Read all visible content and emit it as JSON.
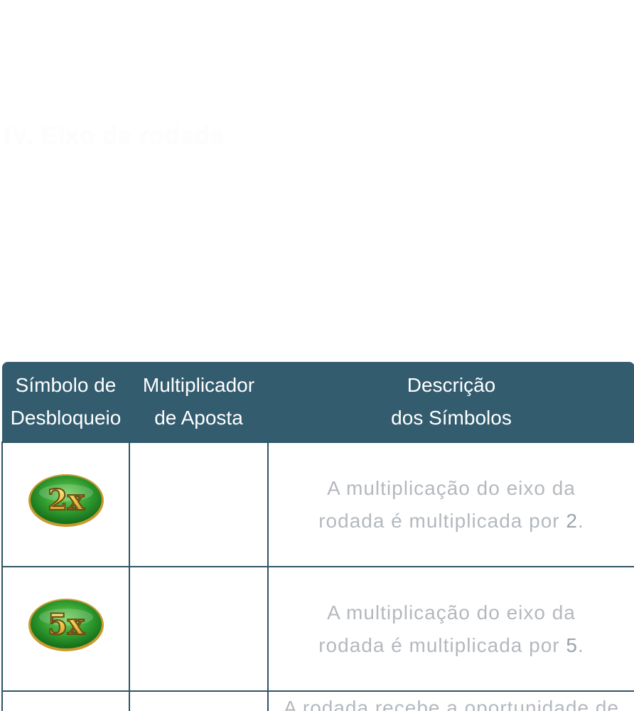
{
  "faint_heading": "IV. Eixo de rodada",
  "table": {
    "headers": [
      "Símbolo de\nDesbloqueio",
      "Multiplicador\nde Aposta",
      "Descrição\ndos Símbolos"
    ],
    "rows": [
      {
        "symbol_label": "2x",
        "bet_multiplier": "",
        "description_prefix": "A multiplicação do eixo da rodada é multiplicada por ",
        "description_value": "2",
        "description_suffix": "."
      },
      {
        "symbol_label": "5x",
        "bet_multiplier": "",
        "description_prefix": "A multiplicação do eixo da rodada é multiplicada por ",
        "description_value": "5",
        "description_suffix": "."
      },
      {
        "symbol_label": "",
        "bet_multiplier": "",
        "description_prefix": "A rodada recebe a oportunidade de",
        "description_value": "",
        "description_suffix": ""
      }
    ]
  },
  "colors": {
    "header_bg": "#335c6e",
    "border": "#2f5465",
    "description_text": "#b4b9be",
    "badge_green": "#2e9a2e",
    "badge_gold": "#f2c84b"
  },
  "icons": {
    "row1": "multiplier-2x-badge-icon",
    "row2": "multiplier-5x-badge-icon"
  }
}
